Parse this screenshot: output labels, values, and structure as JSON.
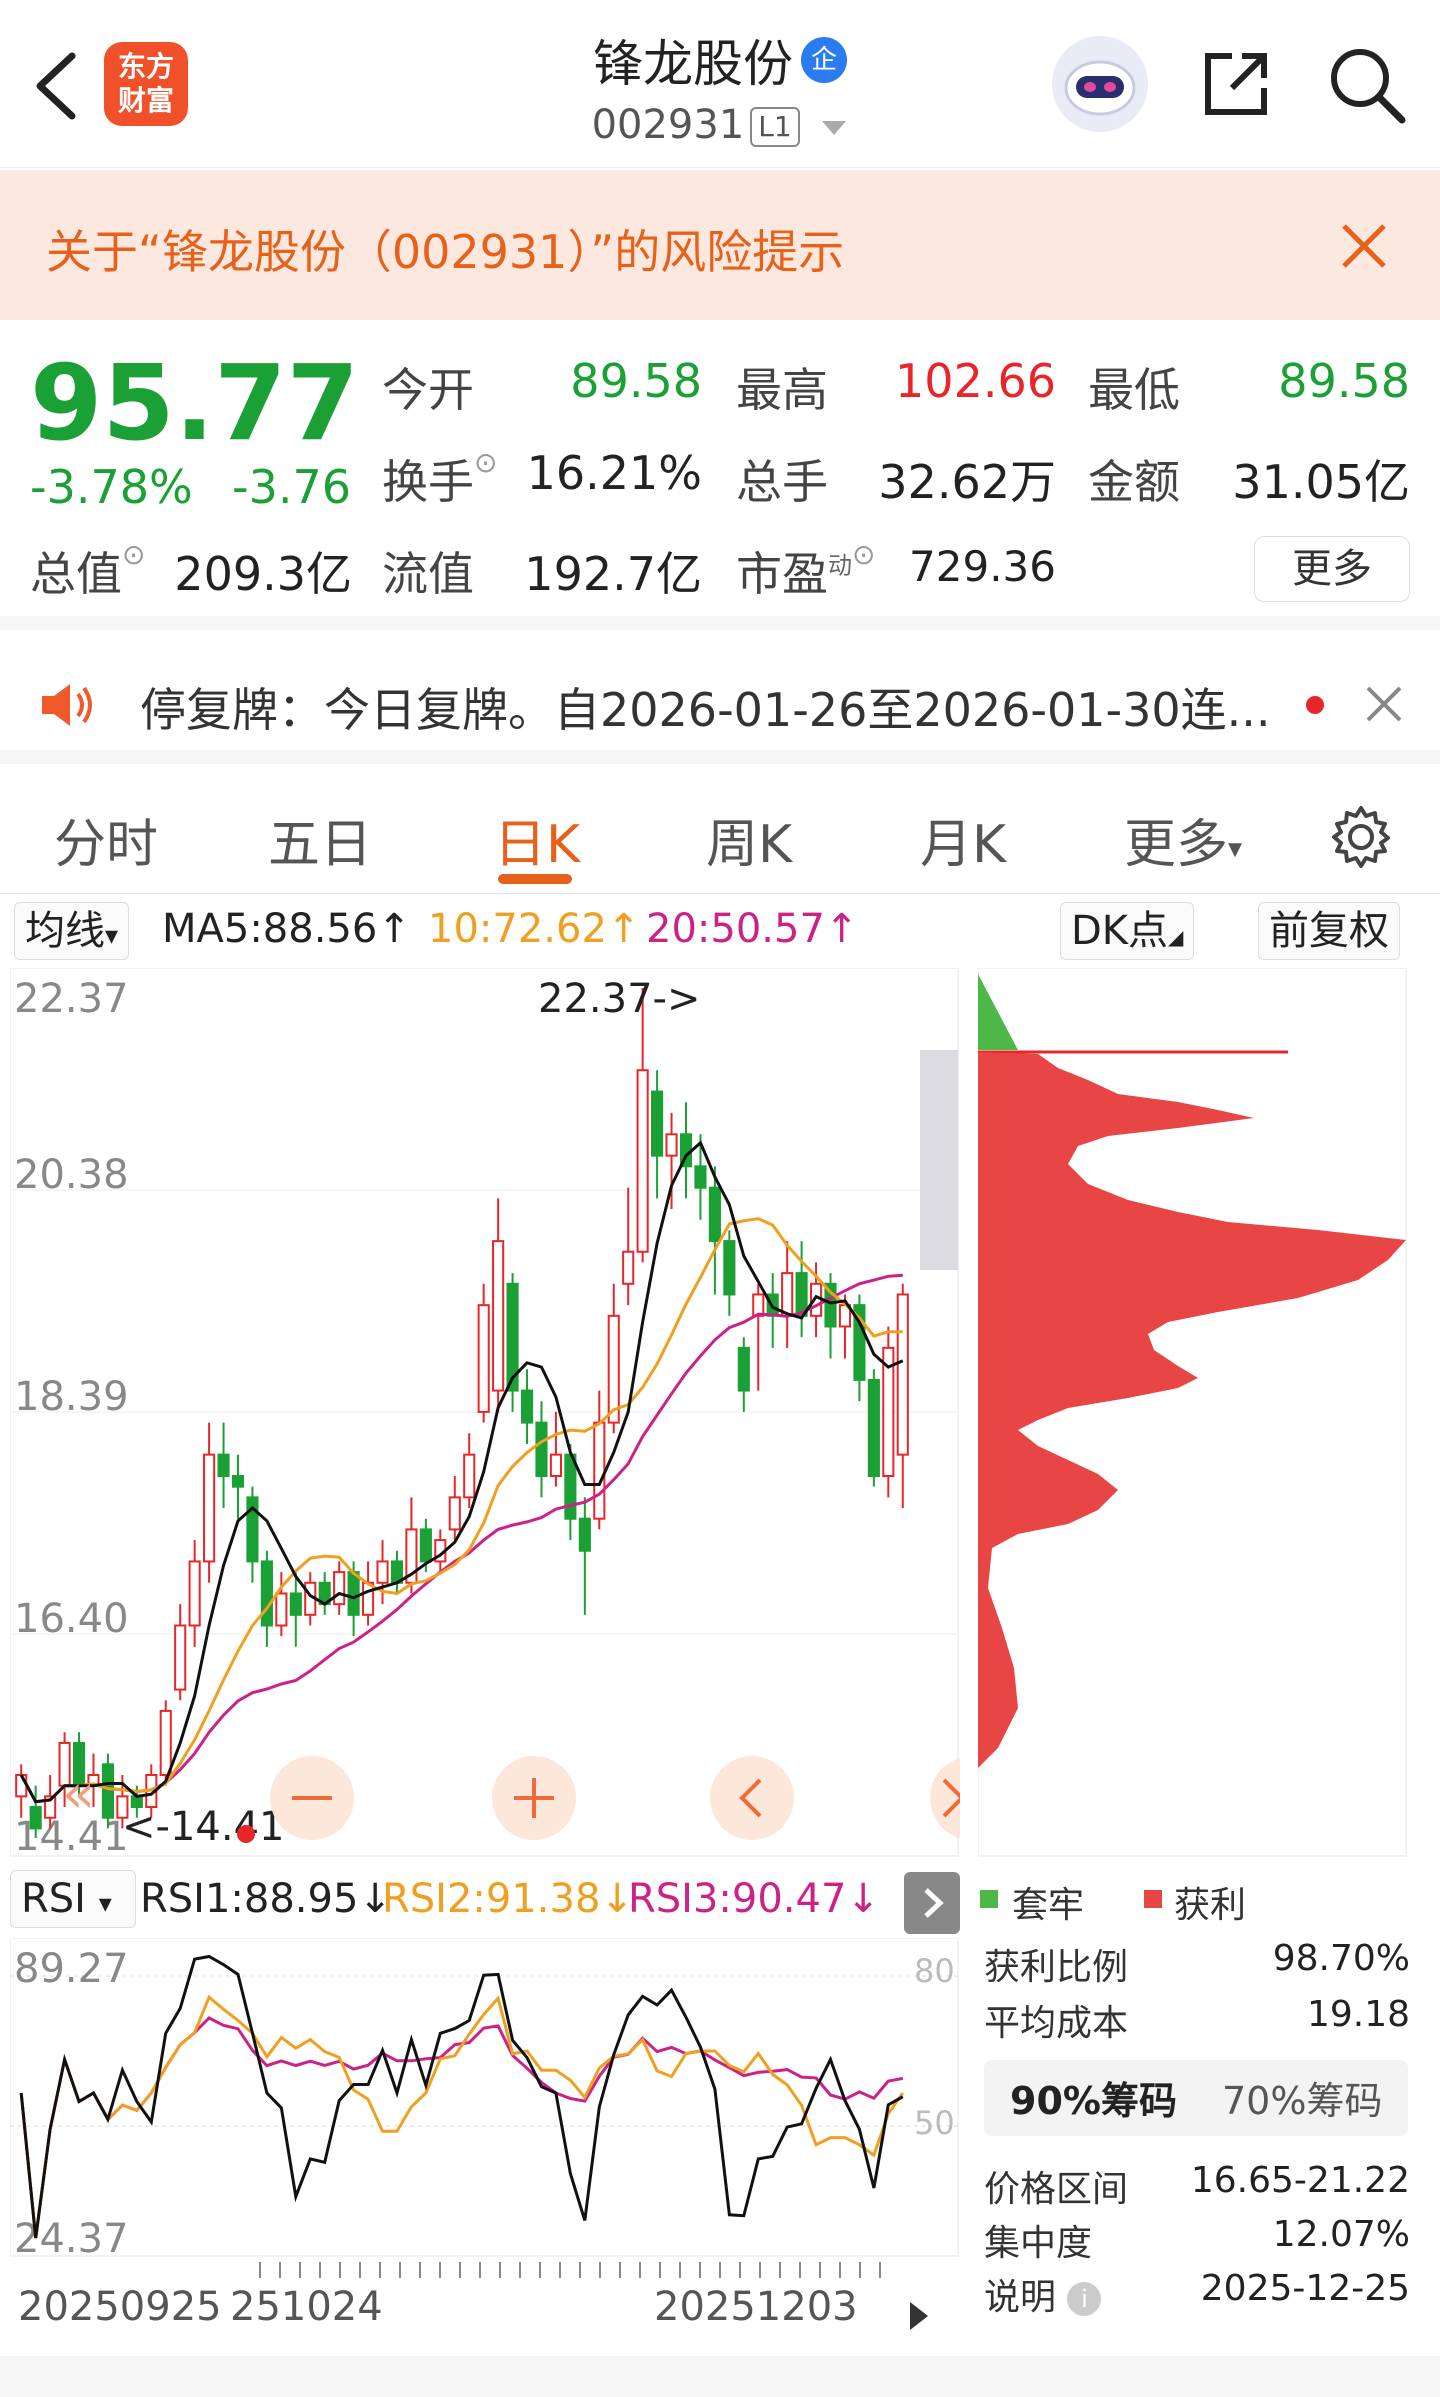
{
  "header": {
    "logo_line1": "东方",
    "logo_line2": "财富",
    "stock_name": "锋龙股份",
    "badge": "企",
    "stock_code": "002931",
    "level": "L1"
  },
  "risk_banner": {
    "text": "关于“锋龙股份（002931）”的风险提示"
  },
  "quote": {
    "price": "95.77",
    "change_pct": "-3.78%",
    "change": "-3.76",
    "open_label": "今开",
    "open": "89.58",
    "high_label": "最高",
    "high": "102.66",
    "low_label": "最低",
    "low": "89.58",
    "turnover_label": "换手",
    "turnover": "16.21%",
    "volume_label": "总手",
    "volume": "32.62万",
    "amount_label": "金额",
    "amount": "31.05亿",
    "mktcap_label": "总值",
    "mktcap": "209.3亿",
    "float_label": "流值",
    "float_cap": "192.7亿",
    "pe_label": "市盈",
    "pe_sup": "动",
    "pe": "729.36",
    "more": "更多"
  },
  "notice": {
    "text": "停复牌：今日复牌。自2026-01-26至2026-01-30连..."
  },
  "tabs": [
    "分时",
    "五日",
    "日K",
    "周K",
    "月K",
    "更多"
  ],
  "active_tab": 2,
  "ma_bar": {
    "selector": "均线",
    "ma5": "MA5:88.56↑",
    "ma10": "10:72.62↑",
    "ma20": "20:50.57↑",
    "dk": "DK点",
    "adjust": "前复权"
  },
  "colors": {
    "up": "#e8262a",
    "down": "#1aa035",
    "ma5": "#111111",
    "ma10": "#f0a020",
    "ma20": "#cc2288",
    "accent": "#e8611a"
  },
  "kline": {
    "y_labels": [
      "22.37",
      "20.38",
      "18.39",
      "16.40",
      "14.41"
    ],
    "high_marker": "22.37->",
    "low_marker": "<-14.41"
  },
  "chart_data": {
    "type": "candlestick",
    "ylim": [
      14.41,
      22.37
    ],
    "x_start": "20250925",
    "x_ticks": [
      "20250925",
      "20251024",
      "20251203"
    ],
    "candles": [
      {
        "o": 14.8,
        "c": 15.0,
        "h": 15.1,
        "l": 14.6
      },
      {
        "o": 14.7,
        "c": 14.5,
        "h": 14.9,
        "l": 14.41
      },
      {
        "o": 14.6,
        "c": 14.8,
        "h": 15.0,
        "l": 14.5
      },
      {
        "o": 14.9,
        "c": 15.3,
        "h": 15.4,
        "l": 14.7
      },
      {
        "o": 15.3,
        "c": 14.9,
        "h": 15.4,
        "l": 14.8
      },
      {
        "o": 14.9,
        "c": 15.0,
        "h": 15.2,
        "l": 14.7
      },
      {
        "o": 15.1,
        "c": 14.6,
        "h": 15.2,
        "l": 14.5
      },
      {
        "o": 14.6,
        "c": 14.8,
        "h": 15.0,
        "l": 14.5
      },
      {
        "o": 14.8,
        "c": 14.7,
        "h": 14.9,
        "l": 14.6
      },
      {
        "o": 14.7,
        "c": 15.0,
        "h": 15.1,
        "l": 14.6
      },
      {
        "o": 15.0,
        "c": 15.6,
        "h": 15.7,
        "l": 14.9
      },
      {
        "o": 15.8,
        "c": 16.4,
        "h": 16.6,
        "l": 15.7
      },
      {
        "o": 16.4,
        "c": 17.0,
        "h": 17.2,
        "l": 16.2
      },
      {
        "o": 17.0,
        "c": 18.0,
        "h": 18.3,
        "l": 16.8
      },
      {
        "o": 18.0,
        "c": 17.8,
        "h": 18.3,
        "l": 17.5
      },
      {
        "o": 17.8,
        "c": 17.7,
        "h": 18.0,
        "l": 17.4
      },
      {
        "o": 17.6,
        "c": 17.0,
        "h": 17.7,
        "l": 16.8
      },
      {
        "o": 17.0,
        "c": 16.4,
        "h": 17.1,
        "l": 16.2
      },
      {
        "o": 16.4,
        "c": 16.7,
        "h": 16.9,
        "l": 16.3
      },
      {
        "o": 16.7,
        "c": 16.5,
        "h": 16.9,
        "l": 16.2
      },
      {
        "o": 16.5,
        "c": 16.8,
        "h": 16.9,
        "l": 16.4
      },
      {
        "o": 16.8,
        "c": 16.6,
        "h": 16.9,
        "l": 16.5
      },
      {
        "o": 16.6,
        "c": 16.9,
        "h": 17.0,
        "l": 16.5
      },
      {
        "o": 16.9,
        "c": 16.5,
        "h": 17.0,
        "l": 16.3
      },
      {
        "o": 16.5,
        "c": 16.8,
        "h": 17.0,
        "l": 16.4
      },
      {
        "o": 16.8,
        "c": 17.0,
        "h": 17.2,
        "l": 16.6
      },
      {
        "o": 17.0,
        "c": 16.8,
        "h": 17.1,
        "l": 16.7
      },
      {
        "o": 16.8,
        "c": 17.3,
        "h": 17.6,
        "l": 16.7
      },
      {
        "o": 17.3,
        "c": 17.0,
        "h": 17.4,
        "l": 16.9
      },
      {
        "o": 17.0,
        "c": 17.2,
        "h": 17.3,
        "l": 16.9
      },
      {
        "o": 17.3,
        "c": 17.6,
        "h": 17.8,
        "l": 17.2
      },
      {
        "o": 17.6,
        "c": 18.0,
        "h": 18.2,
        "l": 17.5
      },
      {
        "o": 18.4,
        "c": 19.4,
        "h": 19.6,
        "l": 18.3
      },
      {
        "o": 18.6,
        "c": 20.0,
        "h": 20.4,
        "l": 18.4
      },
      {
        "o": 19.6,
        "c": 18.6,
        "h": 19.7,
        "l": 18.4
      },
      {
        "o": 18.6,
        "c": 18.3,
        "h": 18.8,
        "l": 18.1
      },
      {
        "o": 18.3,
        "c": 17.8,
        "h": 18.5,
        "l": 17.6
      },
      {
        "o": 17.8,
        "c": 18.0,
        "h": 18.4,
        "l": 17.7
      },
      {
        "o": 18.0,
        "c": 17.4,
        "h": 18.1,
        "l": 17.2
      },
      {
        "o": 17.4,
        "c": 17.1,
        "h": 17.6,
        "l": 16.5
      },
      {
        "o": 17.4,
        "c": 18.3,
        "h": 18.6,
        "l": 17.3
      },
      {
        "o": 18.3,
        "c": 19.3,
        "h": 19.6,
        "l": 18.2
      },
      {
        "o": 19.6,
        "c": 19.9,
        "h": 20.5,
        "l": 19.4
      },
      {
        "o": 19.9,
        "c": 21.6,
        "h": 22.37,
        "l": 19.8
      },
      {
        "o": 21.4,
        "c": 20.8,
        "h": 21.6,
        "l": 20.4
      },
      {
        "o": 20.8,
        "c": 21.0,
        "h": 21.2,
        "l": 20.3
      },
      {
        "o": 21.0,
        "c": 20.7,
        "h": 21.3,
        "l": 20.4
      },
      {
        "o": 20.7,
        "c": 20.5,
        "h": 21.0,
        "l": 20.2
      },
      {
        "o": 20.5,
        "c": 20.0,
        "h": 20.7,
        "l": 19.5
      },
      {
        "o": 20.0,
        "c": 19.5,
        "h": 20.1,
        "l": 19.3
      },
      {
        "o": 19.0,
        "c": 18.6,
        "h": 19.1,
        "l": 18.4
      },
      {
        "o": 19.3,
        "c": 19.5,
        "h": 19.6,
        "l": 18.6
      },
      {
        "o": 19.5,
        "c": 19.3,
        "h": 19.7,
        "l": 19.0
      },
      {
        "o": 19.3,
        "c": 19.7,
        "h": 20.0,
        "l": 19.0
      },
      {
        "o": 19.7,
        "c": 19.3,
        "h": 20.0,
        "l": 19.1
      },
      {
        "o": 19.3,
        "c": 19.6,
        "h": 19.8,
        "l": 19.1
      },
      {
        "o": 19.6,
        "c": 19.2,
        "h": 19.7,
        "l": 18.9
      },
      {
        "o": 19.2,
        "c": 19.4,
        "h": 19.5,
        "l": 18.9
      },
      {
        "o": 19.4,
        "c": 18.7,
        "h": 19.5,
        "l": 18.5
      },
      {
        "o": 18.7,
        "c": 17.8,
        "h": 18.8,
        "l": 17.7
      },
      {
        "o": 17.8,
        "c": 19.0,
        "h": 19.2,
        "l": 17.6
      },
      {
        "o": 18.0,
        "c": 19.5,
        "h": 19.6,
        "l": 17.5
      }
    ]
  },
  "rsi_bar": {
    "label": "RSI",
    "rsi1": "RSI1:88.95↓",
    "rsi2": "RSI2:91.38↓",
    "rsi3": "RSI3:90.47↓"
  },
  "rsi": {
    "y_top": "89.27",
    "y_bottom": "24.37",
    "guide_80": "80",
    "guide_50": "50"
  },
  "dates": {
    "d1": "20250925",
    "d2": "251024",
    "d3": "20251203"
  },
  "chips": {
    "legend_trapped": "套牢",
    "legend_profit": "获利",
    "profit_ratio_label": "获利比例",
    "profit_ratio": "98.70%",
    "avg_cost_label": "平均成本",
    "avg_cost": "19.18",
    "tab_90": "90%筹码",
    "tab_70": "70%筹码",
    "range_label": "价格区间",
    "range": "16.65-21.22",
    "concentration_label": "集中度",
    "concentration": "12.07%",
    "note_label": "说明",
    "note_date": "2025-12-25"
  }
}
